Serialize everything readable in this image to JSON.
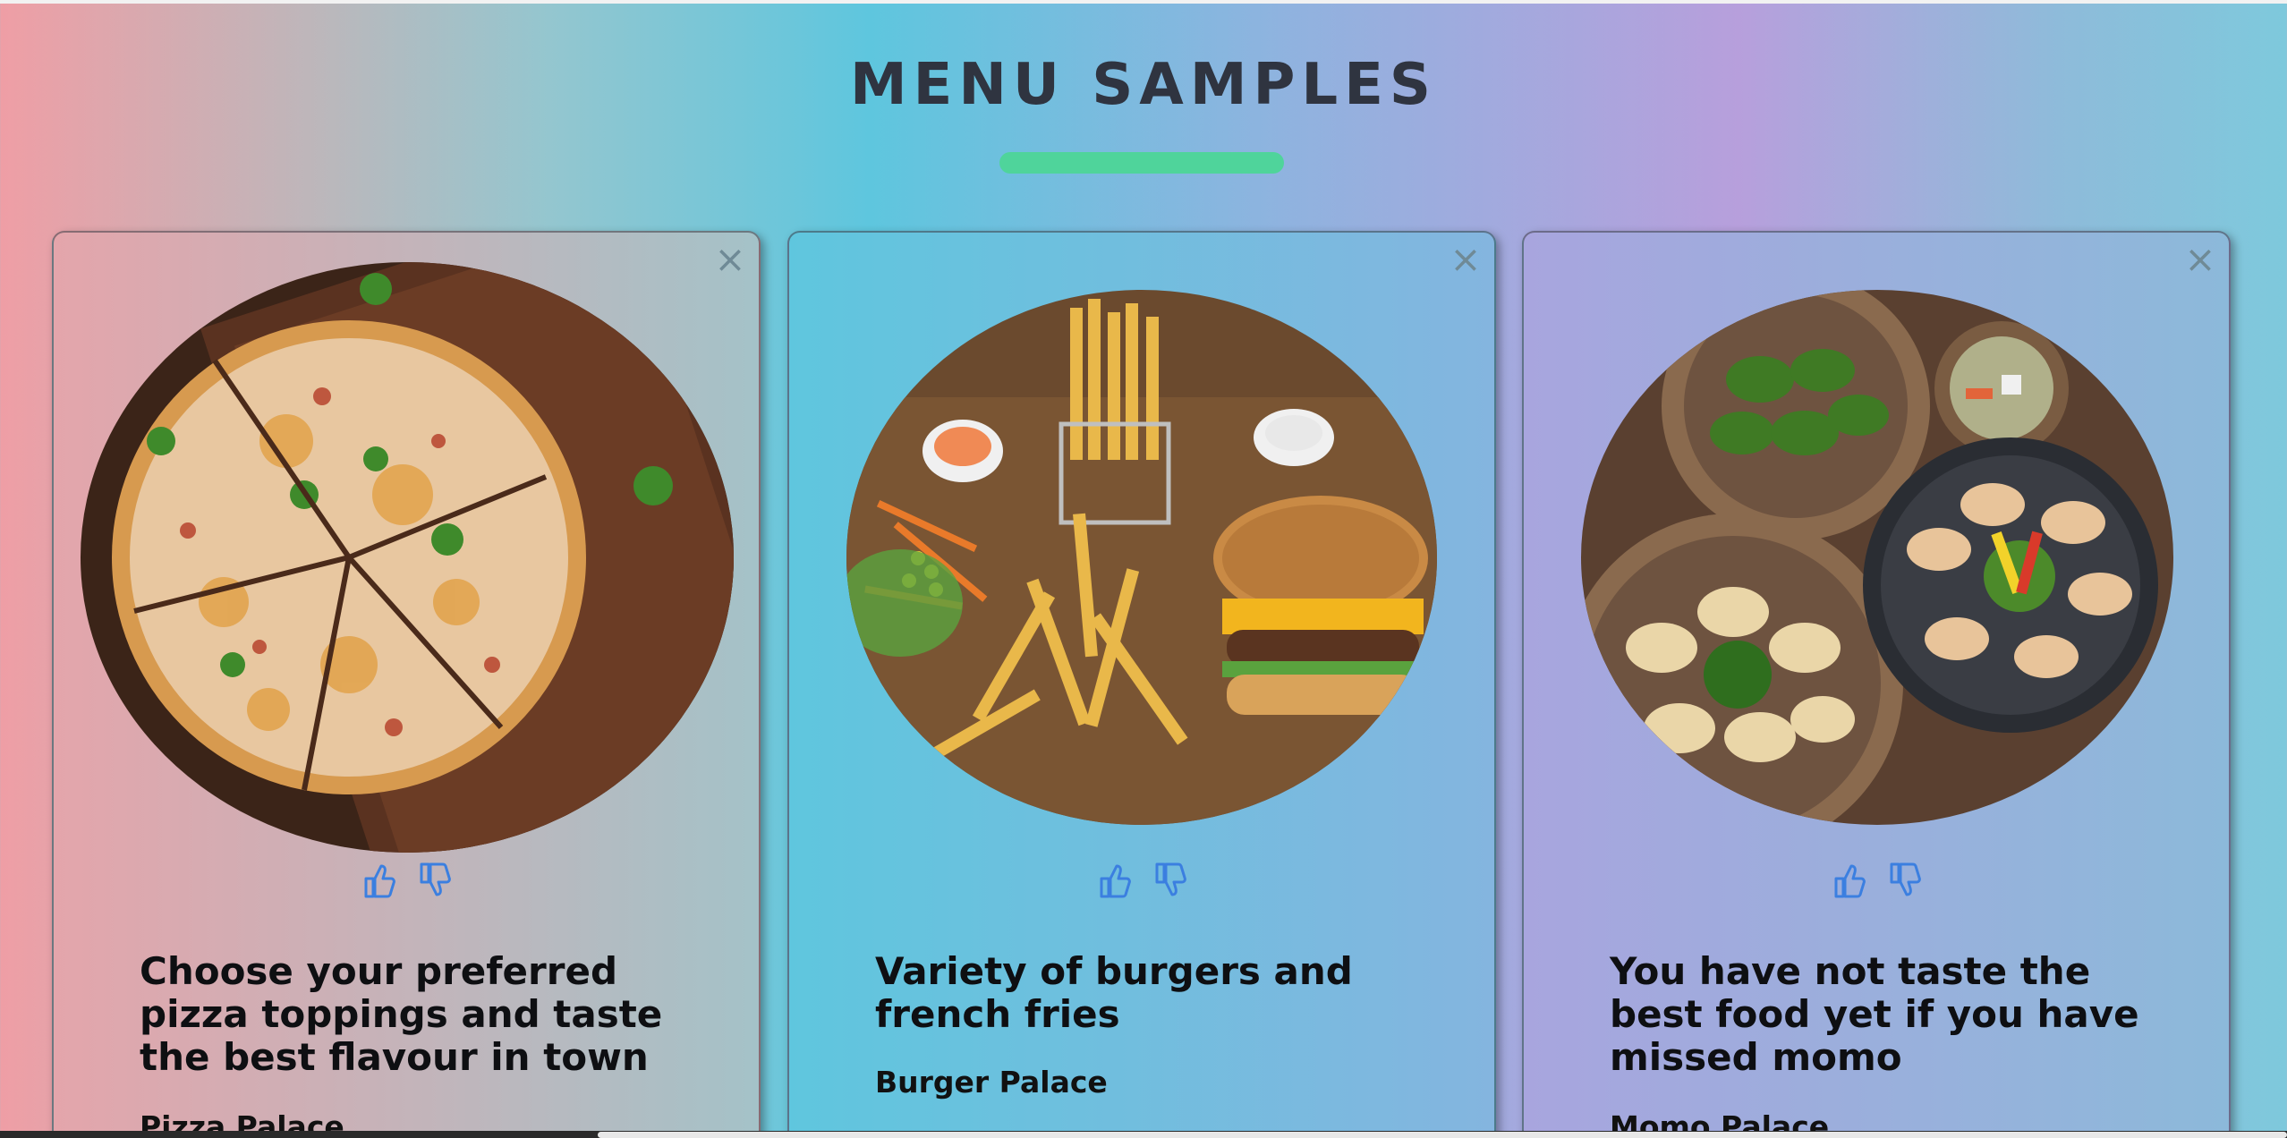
{
  "page": {
    "title": "MENU SAMPLES",
    "accent_color": "#4fd49b"
  },
  "cards": [
    {
      "image_icon": "pizza-photo",
      "caption": "Choose your preferred pizza toppings and taste the best flavour in town",
      "restaurant": "Pizza Palace",
      "close_label": "×",
      "like_icon": "thumbs-up-icon",
      "dislike_icon": "thumbs-down-icon"
    },
    {
      "image_icon": "burger-photo",
      "caption": "Variety of burgers and french fries",
      "restaurant": "Burger Palace",
      "close_label": "×",
      "like_icon": "thumbs-up-icon",
      "dislike_icon": "thumbs-down-icon"
    },
    {
      "image_icon": "momo-photo",
      "caption": "You have not taste the best food yet if you have missed momo",
      "restaurant": "Momo Palace",
      "close_label": "×",
      "like_icon": "thumbs-up-icon",
      "dislike_icon": "thumbs-down-icon"
    }
  ],
  "colors": {
    "vote_icon": "#3b7fe0",
    "close_icon": "#6f8a96"
  }
}
